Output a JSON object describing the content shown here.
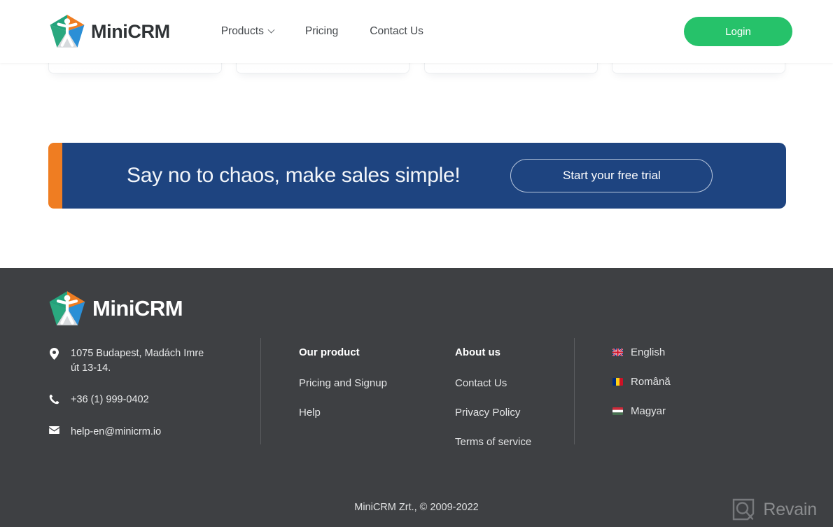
{
  "header": {
    "brand_name": "MiniCRM",
    "nav": [
      {
        "label": "Products",
        "has_dropdown": true
      },
      {
        "label": "Pricing",
        "has_dropdown": false
      },
      {
        "label": "Contact Us",
        "has_dropdown": false
      }
    ],
    "login_label": "Login",
    "login_color": "#26c26a"
  },
  "cta": {
    "headline": "Say no to chaos, make sales simple!",
    "button_label": "Start your free trial",
    "accent_color": "#ef7d22",
    "background_color": "#1e4480"
  },
  "footer": {
    "brand_name": "MiniCRM",
    "background_color": "#3e4043",
    "contact": {
      "address_line1": "1075 Budapest, Madách Imre",
      "address_line2": "út 13-14.",
      "phone": "+36 (1) 999-0402",
      "email": "help-en@minicrm.io"
    },
    "columns": [
      {
        "title": "Our product",
        "links": [
          "Pricing and Signup",
          "Help"
        ]
      },
      {
        "title": "About us",
        "links": [
          "Contact Us",
          "Privacy Policy",
          "Terms of service"
        ]
      }
    ],
    "languages": [
      {
        "label": "English",
        "flag": "united-kingdom-flag-icon"
      },
      {
        "label": "Română",
        "flag": "romania-flag-icon"
      },
      {
        "label": "Magyar",
        "flag": "hungary-flag-icon"
      }
    ],
    "copyright": "MiniCRM Zrt., © 2009-2022"
  },
  "watermark": {
    "label": "Revain"
  }
}
